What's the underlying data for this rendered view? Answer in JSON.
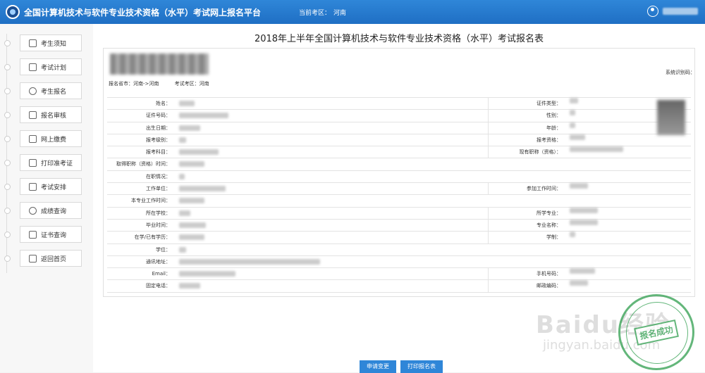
{
  "header": {
    "title": "全国计算机技术与软件专业技术资格（水平）考试网上报名平台",
    "region_label": "当前考区：",
    "region_value": "河南"
  },
  "sidebar": {
    "items": [
      {
        "label": "考生须知",
        "icon": "notice-icon"
      },
      {
        "label": "考试计划",
        "icon": "calendar-icon"
      },
      {
        "label": "考生报名",
        "icon": "clock-icon"
      },
      {
        "label": "报名审核",
        "icon": "document-icon"
      },
      {
        "label": "网上缴费",
        "icon": "computer-icon"
      },
      {
        "label": "打印准考证",
        "icon": "printer-icon"
      },
      {
        "label": "考试安排",
        "icon": "list-icon"
      },
      {
        "label": "成绩查询",
        "icon": "search-icon"
      },
      {
        "label": "证书查询",
        "icon": "certificate-icon"
      },
      {
        "label": "返回首页",
        "icon": "home-icon"
      }
    ]
  },
  "main": {
    "title": "2018年上半年全国计算机技术与软件专业技术资格（水平）考试报名表",
    "meta": {
      "province": "报名省市：河南->河南",
      "exam_area": "考试考区：河南",
      "system_id": "系统识别码："
    },
    "fields": [
      {
        "l1": "姓名：",
        "l2": "证件类型："
      },
      {
        "l1": "证件号码：",
        "l2": "性别："
      },
      {
        "l1": "出生日期：",
        "l2": "年龄："
      },
      {
        "l1": "报考级别：",
        "l2": "报考资格："
      },
      {
        "l1": "报考科目：",
        "l2": "现有职称（资格）："
      },
      {
        "l1": "取得职称（资格）时间：",
        "l2": ""
      },
      {
        "l1": "在职情况：",
        "l2": ""
      },
      {
        "l1": "工作单位：",
        "l2": "参加工作时间："
      },
      {
        "l1": "本专业工作时间：",
        "l2": ""
      },
      {
        "l1": "所在学校：",
        "l2": "所学专业："
      },
      {
        "l1": "毕业时间：",
        "l2": "专业名称："
      },
      {
        "l1": "在学/已有学历：",
        "l2": "学制："
      },
      {
        "l1": "学位：",
        "l2": ""
      },
      {
        "l1": "通讯地址：",
        "l2": ""
      },
      {
        "l1": "Email：",
        "l2": "手机号码："
      },
      {
        "l1": "固定电话：",
        "l2": "邮政编码："
      }
    ],
    "stamp": "报名成功",
    "watermark": "Baidu经验",
    "watermark_url": "jingyan.baidu.com"
  },
  "buttons": {
    "apply_change": "申请变更",
    "print_form": "打印报名表"
  },
  "colors": {
    "accent": "#2f86d8",
    "stamp": "#2f9e4e"
  }
}
